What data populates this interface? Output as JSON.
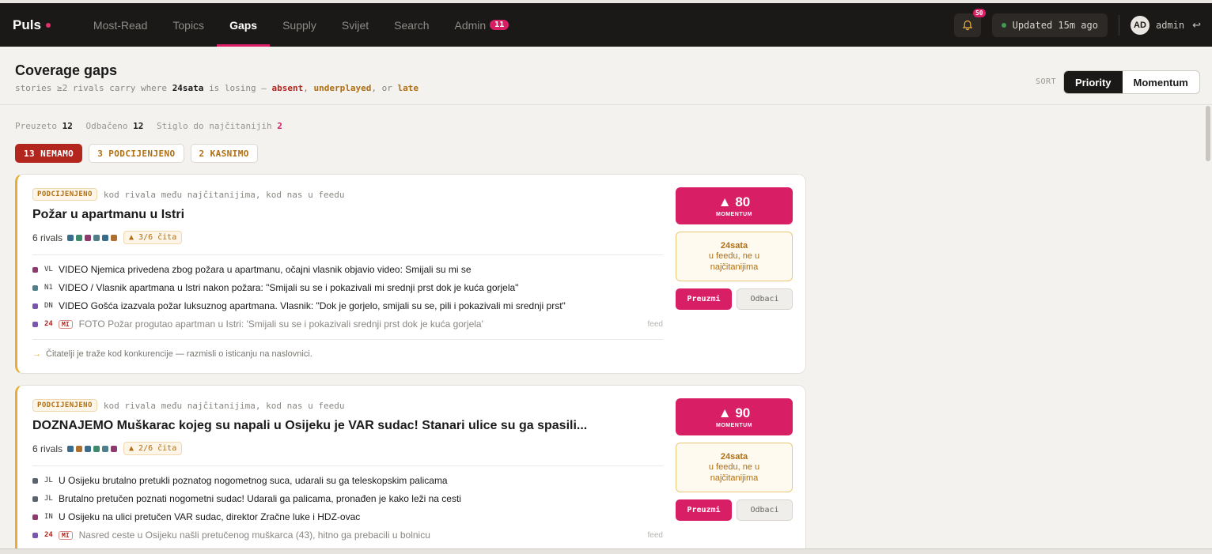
{
  "colors": {
    "accent": "#d81f65",
    "topbar": "#1b1918",
    "underplayed": "#b06e12",
    "absent": "#b3261e"
  },
  "nav": {
    "brand": "Puls",
    "items": [
      {
        "label": "Most-Read"
      },
      {
        "label": "Topics"
      },
      {
        "label": "Gaps",
        "active": true
      },
      {
        "label": "Supply"
      },
      {
        "label": "Svijet"
      },
      {
        "label": "Search"
      },
      {
        "label": "Admin",
        "badge": "11"
      }
    ],
    "notifications_count": "50",
    "updated": "Updated 15m ago",
    "avatar_initials": "AD",
    "username": "admin"
  },
  "header": {
    "title": "Coverage gaps",
    "subtitle_prefix": "stories ≥2 rivals carry where",
    "subtitle_outlet": "24sata",
    "subtitle_mid": "is losing —",
    "absent": "absent",
    "underplayed": "underplayed",
    "or": "or",
    "late": "late",
    "sort_label": "SORT",
    "sort_options": [
      "Priority",
      "Momentum"
    ]
  },
  "stats": {
    "taken_label": "Preuzeto",
    "taken": "12",
    "rejected_label": "Odbačeno",
    "rejected": "12",
    "reached_label": "Stiglo do najčitanijih",
    "reached": "2"
  },
  "filters": [
    {
      "label": "13 NEMAMO",
      "active": true
    },
    {
      "label": "3 PODCIJENJENO"
    },
    {
      "label": "2 KASNIMO"
    }
  ],
  "cards": [
    {
      "tag": "PODCIJENJENO",
      "tag_desc": "kod rivala među najčitanijima, kod nas u feedu",
      "title": "Požar u apartmanu u Istri",
      "rivals": "6 rivals",
      "rival_colors": [
        "#3a6d8c",
        "#3d8a6e",
        "#8d3a6e",
        "#4f7f8a",
        "#3a6d8c",
        "#b06e30"
      ],
      "chita": "▲ 3/6 čita",
      "stories": [
        {
          "color": "#8d3a6e",
          "code": "VL",
          "text": "VIDEO Njemica privedena zbog požara u apartmanu, očajni vlasnik objavio video: Smijali su mi se"
        },
        {
          "color": "#4f7f8a",
          "code": "N1",
          "text": "VIDEO / Vlasnik apartmana u Istri nakon požara: \"Smijali su se i pokazivali mi srednji prst dok je kuća gorjela\""
        },
        {
          "color": "#7a55b0",
          "code": "DN",
          "text": "VIDEO Gošća izazvala požar luksuznog apartmana. Vlasnik: \"Dok je gorjelo, smijali su se, pili i pokazivali mi srednji prst\""
        },
        {
          "color": "#7a55b0",
          "code": "24",
          "own": true,
          "mi": "MI",
          "text": "FOTO Požar progutao apartman u Istri: 'Smijali su se i pokazivali srednji prst dok je kuća gorjela'",
          "source": "feed"
        }
      ],
      "hint": "Čitatelji je traže kod konkurencije — razmisli o isticanju na naslovnici.",
      "momentum": "▲ 80",
      "momentum_label": "MOMENTUM",
      "own_name": "24sata",
      "own_status": "u feedu, ne u najčitanijima",
      "take": "Preuzmi",
      "reject": "Odbaci"
    },
    {
      "tag": "PODCIJENJENO",
      "tag_desc": "kod rivala među najčitanijima, kod nas u feedu",
      "title": "DOZNAJEMO Muškarac kojeg su napali u Osijeku je VAR sudac! Stanari ulice su ga spasili...",
      "rivals": "6 rivals",
      "rival_colors": [
        "#3a6d8c",
        "#b06e30",
        "#3a6d8c",
        "#3d8a6e",
        "#4f7f8a",
        "#8d3a6e"
      ],
      "chita": "▲ 2/6 čita",
      "stories": [
        {
          "color": "#5a6470",
          "code": "JL",
          "text": "U Osijeku brutalno pretukli poznatog nogometnog suca, udarali su ga teleskopskim palicama"
        },
        {
          "color": "#5a6470",
          "code": "JL",
          "text": "Brutalno pretučen poznati nogometni sudac! Udarali ga palicama, pronađen je kako leži na cesti"
        },
        {
          "color": "#8d3a6e",
          "code": "IN",
          "text": "U Osijeku na ulici pretučen VAR sudac, direktor Zračne luke i HDZ-ovac"
        },
        {
          "color": "#7a55b0",
          "code": "24",
          "own": true,
          "mi": "MI",
          "text": "Nasred ceste u Osijeku našli pretučenog muškarca (43), hitno ga prebacili u bolnicu",
          "source": "feed"
        }
      ],
      "momentum": "▲ 90",
      "momentum_label": "MOMENTUM",
      "own_name": "24sata",
      "own_status": "u feedu, ne u najčitanijima",
      "take": "Preuzmi",
      "reject": "Odbaci"
    }
  ]
}
